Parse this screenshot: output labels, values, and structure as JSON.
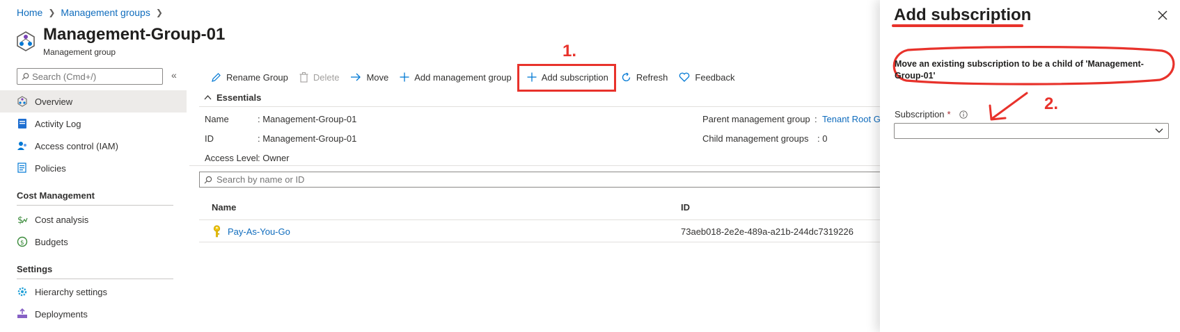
{
  "breadcrumb": {
    "home": "Home",
    "management_groups": "Management groups"
  },
  "header": {
    "title": "Management-Group-01",
    "subtitle": "Management group"
  },
  "sidebar": {
    "search_placeholder": "Search (Cmd+/)",
    "collapse": "«",
    "items": [
      {
        "label": "Overview",
        "icon": "overview-icon"
      },
      {
        "label": "Activity Log",
        "icon": "activity-log-icon"
      },
      {
        "label": "Access control (IAM)",
        "icon": "iam-icon"
      },
      {
        "label": "Policies",
        "icon": "policies-icon"
      }
    ],
    "section_cost": "Cost Management",
    "cost_items": [
      {
        "label": "Cost analysis",
        "icon": "cost-analysis-icon"
      },
      {
        "label": "Budgets",
        "icon": "budgets-icon"
      }
    ],
    "section_settings": "Settings",
    "settings_items": [
      {
        "label": "Hierarchy settings",
        "icon": "gear-icon"
      },
      {
        "label": "Deployments",
        "icon": "deployments-icon"
      }
    ]
  },
  "toolbar": {
    "rename": "Rename Group",
    "delete": "Delete",
    "move": "Move",
    "add_mg": "Add management group",
    "add_sub": "Add subscription",
    "refresh": "Refresh",
    "feedback": "Feedback"
  },
  "annotations": {
    "step1": "1.",
    "step2": "2."
  },
  "essentials": {
    "heading": "Essentials",
    "name_label": "Name",
    "name_value": ": Management-Group-01",
    "id_label": "ID",
    "id_value": ": Management-Group-01",
    "access_label": "Access Level",
    "access_value": ": Owner",
    "parent_label": "Parent management group",
    "parent_sep": ":",
    "parent_value": "Tenant Root G",
    "child_label": "Child management groups",
    "child_value": ": 0"
  },
  "table": {
    "search_placeholder": "Search by name or ID",
    "columns": [
      "Name",
      "ID"
    ],
    "rows": [
      {
        "name": "Pay-As-You-Go",
        "id": "73aeb018-2e2e-489a-a21b-244dc7319226"
      }
    ]
  },
  "blade": {
    "title": "Add subscription",
    "description": "Move an existing subscription to be a child of 'Management-Group-01'",
    "subscription_label": "Subscription",
    "required": "*",
    "subscription_value": ""
  },
  "colors": {
    "accent": "#0f6cbd",
    "annotation_red": "#e8322b",
    "active_nav": "#edebe9"
  }
}
